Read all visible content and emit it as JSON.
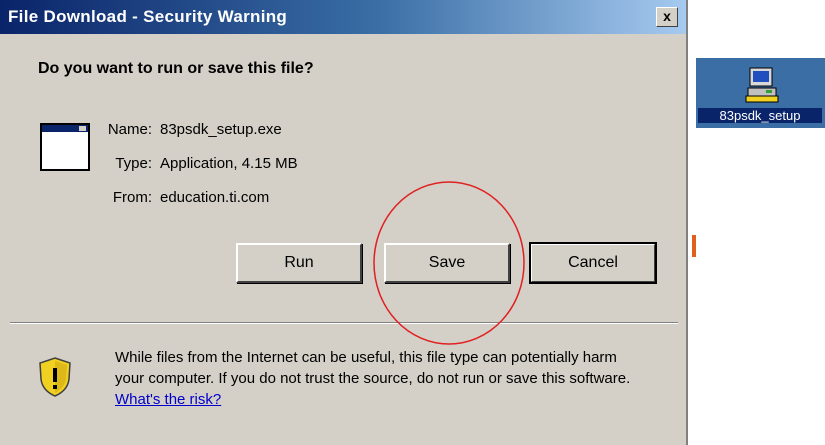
{
  "window": {
    "title": "File Download - Security Warning",
    "close_label": "x"
  },
  "question": "Do you want to run or save this file?",
  "file_info": {
    "name_label": "Name:",
    "name_value": "83psdk_setup.exe",
    "type_label": "Type:",
    "type_value": "Application, 4.15 MB",
    "from_label": "From:",
    "from_value": "education.ti.com"
  },
  "buttons": {
    "run": "Run",
    "save": "Save",
    "cancel": "Cancel"
  },
  "warning": {
    "text": "While files from the Internet can be useful, this file type can potentially harm your computer. If you do not trust the source, do not run or save this software.",
    "link": "What's the risk?"
  },
  "desktop_icon": {
    "label": "83psdk_setup",
    "icon": "installer-icon"
  },
  "colors": {
    "title_bar": "#0a246a",
    "dialog_bg": "#d4d0c8",
    "highlight_circle": "#e02020",
    "link": "#0000cc"
  }
}
